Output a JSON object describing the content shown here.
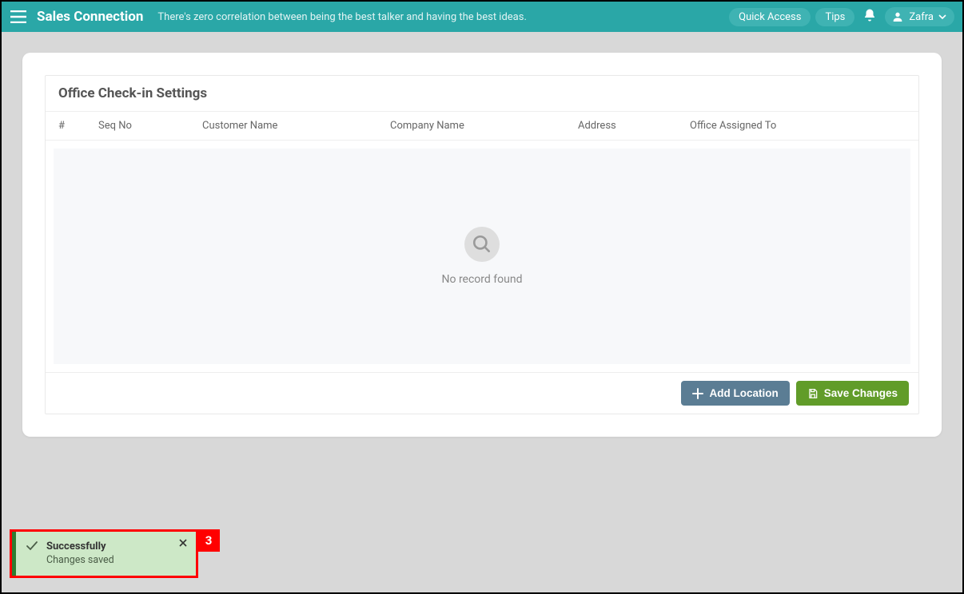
{
  "header": {
    "app_title": "Sales Connection",
    "tagline": "There's zero correlation between being the best talker and having the best ideas.",
    "quick_access": "Quick Access",
    "tips": "Tips",
    "username": "Zafra"
  },
  "panel": {
    "title": "Office Check-in Settings",
    "columns": {
      "idx": "#",
      "seq": "Seq No",
      "customer": "Customer Name",
      "company": "Company Name",
      "address": "Address",
      "office": "Office Assigned To"
    },
    "empty_message": "No record found",
    "add_button": "Add Location",
    "save_button": "Save Changes"
  },
  "toast": {
    "title": "Successfully",
    "message": "Changes saved",
    "annotation_number": "3"
  }
}
